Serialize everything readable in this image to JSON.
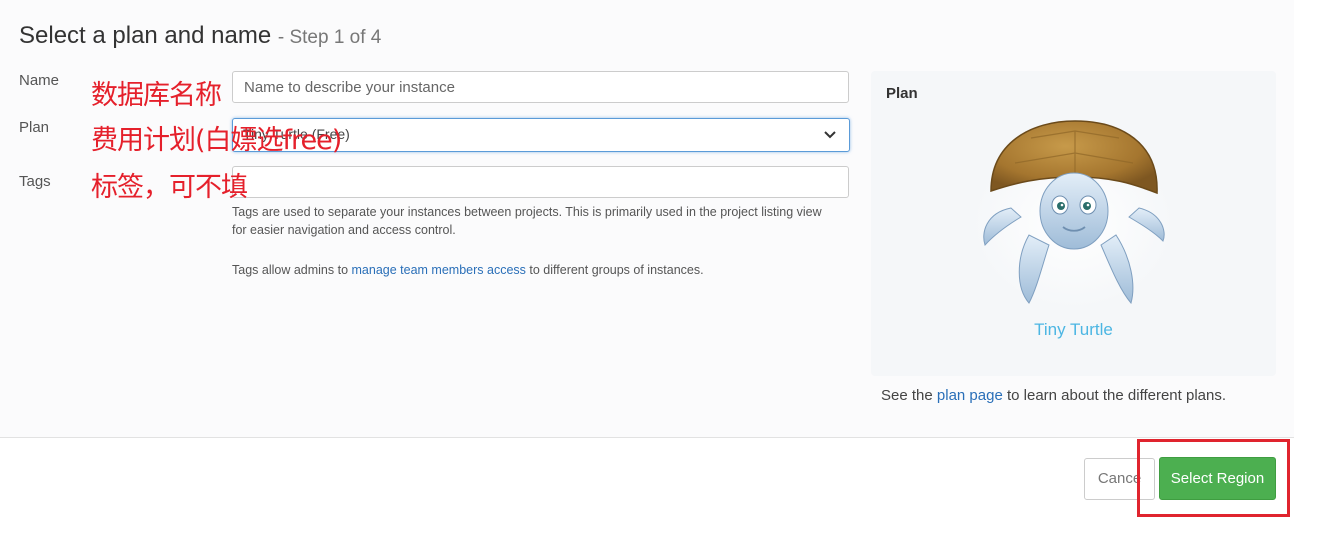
{
  "header": {
    "title": "Select a plan and name",
    "step": "- Step 1 of 4"
  },
  "form": {
    "name_label": "Name",
    "name_placeholder": "Name to describe your instance",
    "plan_label": "Plan",
    "plan_value": "Tiny Turtle (Free)",
    "tags_label": "Tags",
    "tags_help_1": "Tags are used to separate your instances between projects. This is primarily used in the project listing view for easier navigation and access control.",
    "tags_help_2_pre": "Tags allow admins to",
    "tags_help_2_link": "manage team members access",
    "tags_help_2_post": "to different groups of instances."
  },
  "annotations": {
    "name_note": "数据库名称",
    "plan_note": "费用计划(白嫖选free)",
    "tags_note": "标签，可不填"
  },
  "plan_card": {
    "title": "Plan",
    "plan_name": "Tiny Turtle",
    "icon": "turtle-illustration"
  },
  "plan_info": {
    "pre": "See the",
    "link": "plan page",
    "post": "to learn about the different plans."
  },
  "footer": {
    "cancel_label": "Cance",
    "primary_label": "Select Region"
  },
  "colors": {
    "primary": "#4caf50",
    "link": "#2a6fb8",
    "annotation": "#e5202b",
    "plan_name": "#4cb6e3"
  }
}
